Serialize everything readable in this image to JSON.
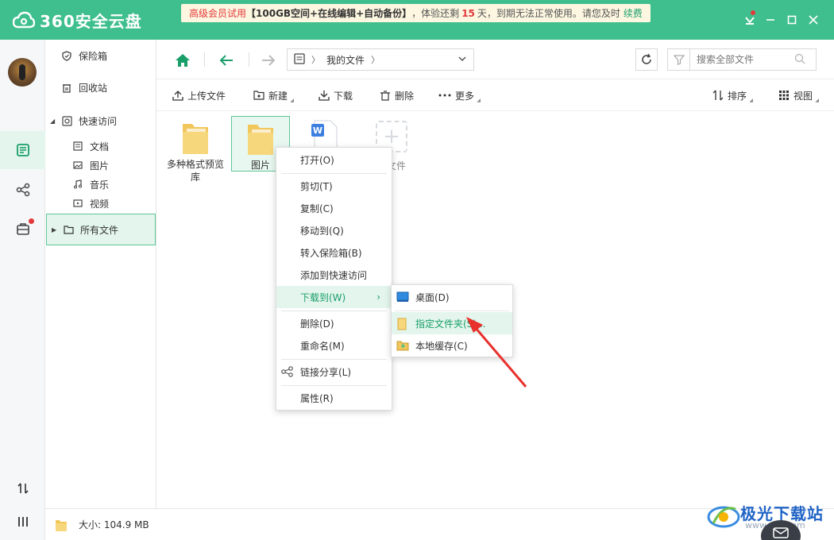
{
  "app": {
    "name": "360安全云盘",
    "promo": {
      "trial": "高级会员试用",
      "feature": "【100GB空间+在线编辑+自动备份】",
      "text1": "，体验还剩",
      "days": "15",
      "text2": "天",
      "text3": "，到期无法正常使用。请您及时",
      "renew": "续费"
    },
    "colors": {
      "brand": "#3fbf8d",
      "accent": "#1a9e6a",
      "alert": "#e4393c"
    }
  },
  "nav": {
    "items": [
      {
        "label": "保险箱",
        "icon": "shield-icon"
      },
      {
        "label": "回收站",
        "icon": "trash-icon"
      },
      {
        "label": "快速访问",
        "icon": "quick-access-icon"
      },
      {
        "label": "文档",
        "icon": "document-icon"
      },
      {
        "label": "图片",
        "icon": "image-icon"
      },
      {
        "label": "音乐",
        "icon": "music-icon"
      },
      {
        "label": "视频",
        "icon": "video-icon"
      },
      {
        "label": "所有文件",
        "icon": "folder-icon"
      }
    ]
  },
  "address": {
    "crumb": "我的文件",
    "search_placeholder": "搜索全部文件"
  },
  "toolbar": {
    "upload": "上传文件",
    "new": "新建",
    "download": "下载",
    "delete": "删除",
    "more": "更多",
    "sort": "排序",
    "view": "视图"
  },
  "files": [
    {
      "name": "多种格式预览库",
      "type": "folder"
    },
    {
      "name": "图片",
      "type": "folder",
      "selected": true
    },
    {
      "name": "",
      "type": "word-doc"
    }
  ],
  "add_file_label": "文件",
  "context_menu": {
    "items": [
      "打开(O)",
      "剪切(T)",
      "复制(C)",
      "移动到(Q)",
      "转入保险箱(B)",
      "添加到快速访问",
      "下载到(W)",
      "删除(D)",
      "重命名(M)",
      "链接分享(L)",
      "属性(R)"
    ],
    "active_index": 6
  },
  "submenu": {
    "items": [
      "桌面(D)",
      "指定文件夹(S)...",
      "本地缓存(C)"
    ],
    "active_index": 1
  },
  "status": {
    "size_label": "大小: 104.9 MB"
  },
  "watermark": {
    "text": "极光下载站",
    "url": "www.xz7.com"
  }
}
